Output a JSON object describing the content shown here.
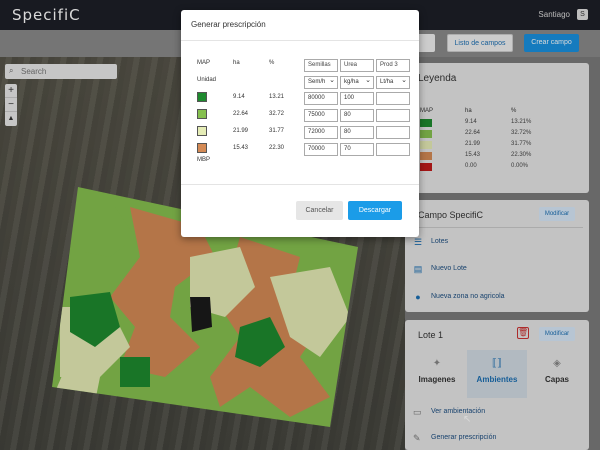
{
  "app": {
    "logo": "SpecifiC",
    "user": "Santiago",
    "user_initial": "S"
  },
  "toolbar": {
    "fields_list": "Listo de campos",
    "create_field": "Crear campo"
  },
  "map": {
    "search_placeholder": "Search",
    "zoom_in": "+",
    "zoom_out": "−",
    "north": "▲"
  },
  "legend": {
    "title": "Leyenda",
    "headers": {
      "map": "MAP",
      "ha": "ha",
      "pct": "%"
    },
    "rows": [
      {
        "color": "#1e8a2e",
        "ha": "9.14",
        "pct": "13.21%"
      },
      {
        "color": "#86c04f",
        "ha": "22.64",
        "pct": "32.72%"
      },
      {
        "color": "#e5ecb6",
        "ha": "21.99",
        "pct": "31.77%"
      },
      {
        "color": "#d48a55",
        "ha": "15.43",
        "pct": "22.30%"
      },
      {
        "color": "#c01a1a",
        "ha": "0.00",
        "pct": "0.00%"
      }
    ]
  },
  "campo": {
    "title": "Campo SpecifiC",
    "modify": "Modificar",
    "items": [
      "Lotes",
      "Nuevo Lote",
      "Nueva zona no agricola"
    ]
  },
  "lote": {
    "title": "Lote 1",
    "modify": "Modificar",
    "tabs": [
      "Imagenes",
      "Ambientes",
      "Capas"
    ],
    "links": [
      "Ver ambientación",
      "Generar prescripción"
    ]
  },
  "modal": {
    "title": "Generar prescripción",
    "left_headers": {
      "map": "MAP",
      "ha": "ha",
      "pct": "%",
      "unit": "Unidad",
      "mbp": "MBP"
    },
    "rows": [
      {
        "color": "#1e8a2e",
        "ha": "9.14",
        "pct": "13.21",
        "semillas": "80000",
        "urea": "100",
        "prod3": ""
      },
      {
        "color": "#86c04f",
        "ha": "22.64",
        "pct": "32.72",
        "semillas": "75000",
        "urea": "80",
        "prod3": ""
      },
      {
        "color": "#e5ecb6",
        "ha": "21.99",
        "pct": "31.77",
        "semillas": "72000",
        "urea": "80",
        "prod3": ""
      },
      {
        "color": "#d48a55",
        "ha": "15.43",
        "pct": "22.30",
        "semillas": "70000",
        "urea": "70",
        "prod3": ""
      }
    ],
    "col_headers": [
      "Semillas",
      "Urea",
      "Prod 3"
    ],
    "col_units": [
      "Sem/h",
      "kg/ha",
      "Lt/ha"
    ],
    "cancel": "Cancelar",
    "download": "Descargar"
  }
}
